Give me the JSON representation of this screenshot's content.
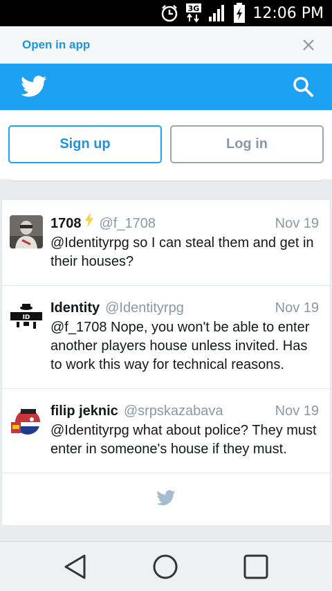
{
  "status_bar": {
    "time": "12:06 PM",
    "network": "3G"
  },
  "banner": {
    "open_in_app": "Open in app"
  },
  "auth": {
    "signup": "Sign up",
    "login": "Log in"
  },
  "tweets": [
    {
      "name": "1708",
      "handle": "@f_1708",
      "date": "Nov 19",
      "text": "@Identityrpg so I can steal them and get in their houses?"
    },
    {
      "name": "Identity",
      "handle": "@Identityrpg",
      "date": "Nov 19",
      "text": "@f_1708 Nope, you won't be able to enter another players house unless invited. Has to work this way for technical reasons."
    },
    {
      "name": "filip jeknic",
      "handle": "@srpskazabava",
      "date": "Nov 19",
      "text": "@Identityrpg what about police? They must enter in someone's house if they must."
    }
  ],
  "colors": {
    "brand": "#1da1f2",
    "link": "#1b95e0",
    "muted": "#8899a6",
    "text": "#14171a"
  },
  "icons": [
    "alarm-icon",
    "network-3g-icon",
    "signal-icon",
    "battery-charging-icon",
    "close-icon",
    "twitter-bird-icon",
    "search-icon",
    "lightning-icon",
    "back-icon",
    "home-icon",
    "recents-icon"
  ]
}
